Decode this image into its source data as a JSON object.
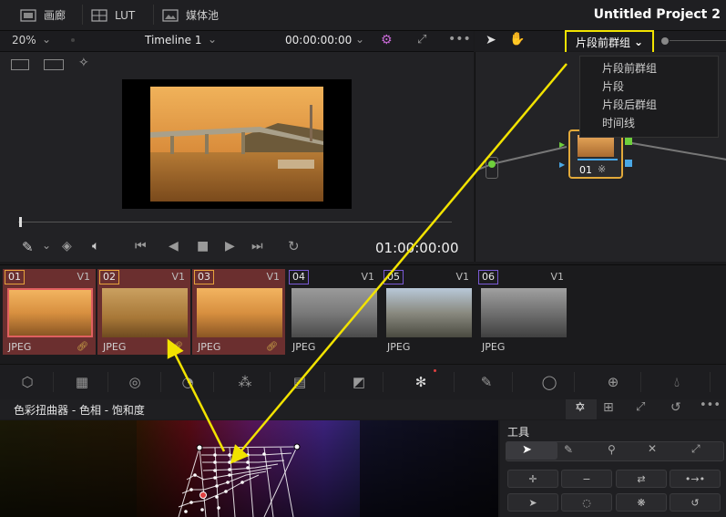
{
  "topbar": {
    "gallery_label": "画廊",
    "lut_label": "LUT",
    "mediapool_label": "媒体池",
    "project_title": "Untitled Project 2"
  },
  "viewer_bar": {
    "zoom": "20%",
    "timeline": "Timeline 1",
    "timecode": "00:00:00:00"
  },
  "node_bar": {
    "mode_dropdown": "片段前群组"
  },
  "dropdown": {
    "items": [
      "片段前群组",
      "片段",
      "片段后群组",
      "时间线"
    ]
  },
  "node": {
    "label": "01"
  },
  "viewer": {
    "timecode": "01:00:00:00"
  },
  "clips": [
    {
      "num": "01",
      "track": "V1",
      "format": "JPEG",
      "linked": true
    },
    {
      "num": "02",
      "track": "V1",
      "format": "JPEG",
      "linked": true
    },
    {
      "num": "03",
      "track": "V1",
      "format": "JPEG",
      "linked": true
    },
    {
      "num": "04",
      "track": "V1",
      "format": "JPEG",
      "linked": false
    },
    {
      "num": "05",
      "track": "V1",
      "format": "JPEG",
      "linked": false
    },
    {
      "num": "06",
      "track": "V1",
      "format": "JPEG",
      "linked": false
    }
  ],
  "panel": {
    "title": "色彩扭曲器 - 色相 - 饱和度",
    "tools_label": "工具"
  },
  "colors": {
    "accent_yellow": "#f2e300",
    "clip_selected": "#6b2f2f",
    "node_border": "#e2a93a"
  }
}
